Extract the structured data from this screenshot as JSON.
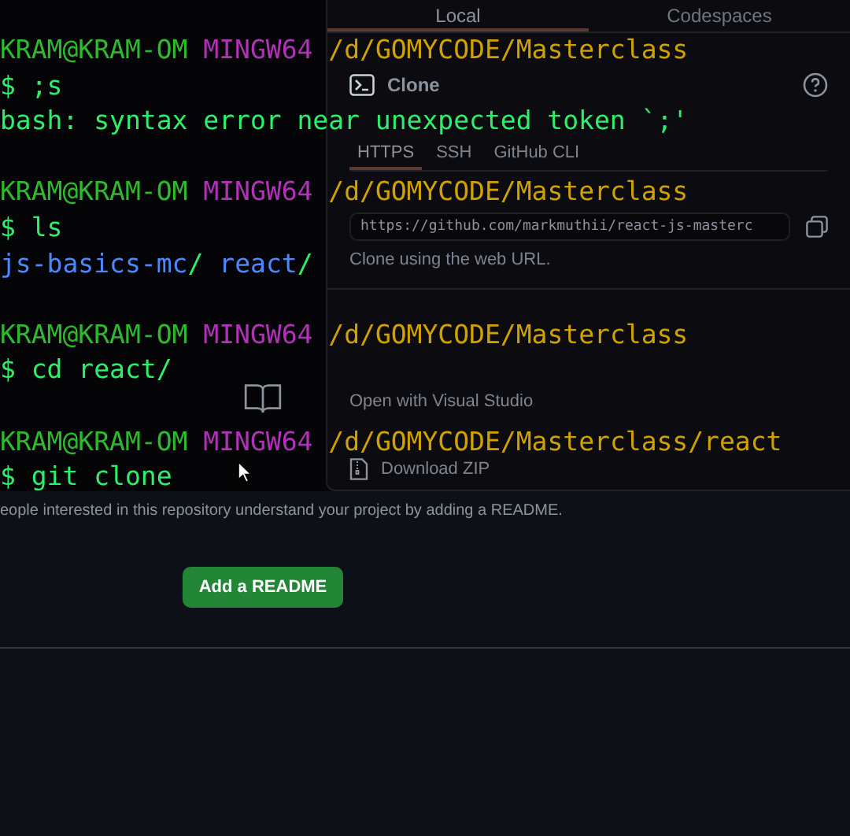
{
  "github_page": {
    "clone_menu": {
      "tabs": [
        {
          "label": "Local",
          "selected": true
        },
        {
          "label": "Codespaces",
          "selected": false
        }
      ],
      "title": "Clone",
      "protocols": [
        {
          "label": "HTTPS",
          "selected": true
        },
        {
          "label": "SSH",
          "selected": false
        },
        {
          "label": "GitHub CLI",
          "selected": false
        }
      ],
      "url": "https://github.com/markmuthii/react-js-masterc",
      "url_hint": "Clone using the web URL.",
      "actions": [
        {
          "kind": "plain",
          "label": "Open with Visual Studio"
        },
        {
          "kind": "zip",
          "label": "Download ZIP"
        }
      ]
    },
    "readme_description": "eople interested in this repository understand your project by adding a README.",
    "readme_button": "Add a README"
  },
  "terminal": {
    "blocks": [
      {
        "user": "KRAM@KRAM-OM",
        "system": "MINGW64",
        "path": "/d/GOMYCODE/Masterclass",
        "command": "$ ;s",
        "output": {
          "kind": "text",
          "text": "bash: syntax error near unexpected token `;'"
        }
      },
      {
        "user": "KRAM@KRAM-OM",
        "system": "MINGW64",
        "path": "/d/GOMYCODE/Masterclass",
        "command": "$ ls",
        "output": {
          "kind": "listing",
          "entries": [
            "js-basics-mc/",
            "react/"
          ]
        }
      },
      {
        "user": "KRAM@KRAM-OM",
        "system": "MINGW64",
        "path": "/d/GOMYCODE/Masterclass",
        "command": "$ cd react/"
      },
      {
        "user": "KRAM@KRAM-OM",
        "system": "MINGW64",
        "path": "/d/GOMYCODE/Masterclass/react",
        "command": "$ git clone"
      }
    ]
  }
}
